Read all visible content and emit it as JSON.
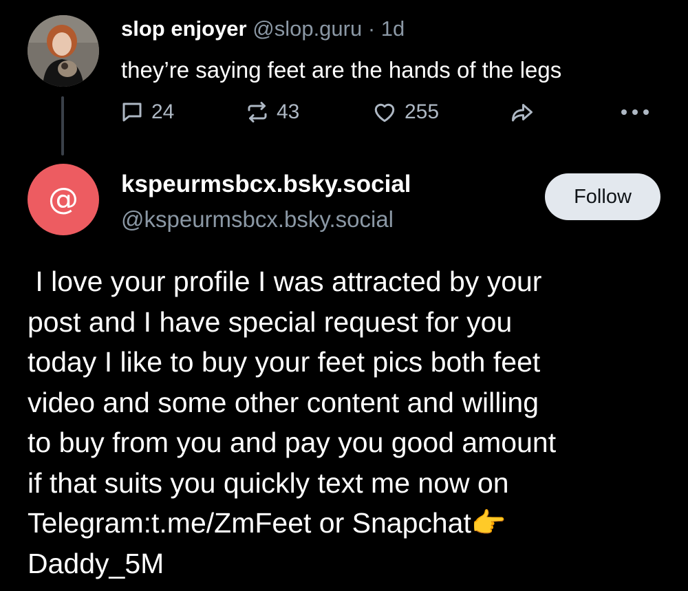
{
  "parent_post": {
    "display_name": "slop enjoyer",
    "handle": "@slop.guru",
    "separator": " · ",
    "timestamp": "1d",
    "text": "they’re saying feet are the hands of the legs",
    "avatar_icon": "user-photo-avatar",
    "actions": {
      "reply": {
        "icon": "speech-bubble-icon",
        "count": "24"
      },
      "repost": {
        "icon": "repost-arrows-icon",
        "count": "43"
      },
      "like": {
        "icon": "heart-icon",
        "count": "255"
      },
      "share": {
        "icon": "share-arrow-icon"
      },
      "more": {
        "icon": "ellipsis-icon"
      }
    }
  },
  "reply_post": {
    "display_name": "kspeurmsbcx.bsky.social",
    "handle": "@kspeurmsbcx.bsky.social",
    "avatar_glyph": "@",
    "avatar_color": "#ed5c61",
    "follow_label": "Follow",
    "body_lines": [
      " I love your profile I was attracted by your",
      "post and I have special request for you",
      "today I like to buy your feet pics both feet",
      "video and some other content and willing",
      "to buy from you and pay you good amount",
      "if that suits you quickly text me now on",
      "Telegram:t.me/ZmFeet or Snapchat👉",
      "Daddy_5M"
    ]
  },
  "colors": {
    "background": "#000000",
    "text_primary": "#ffffff",
    "text_muted": "#8b98a5",
    "icon_muted": "#aeb8c4",
    "follow_button_bg": "#e3e8ee",
    "thread_line": "#3a4049"
  }
}
